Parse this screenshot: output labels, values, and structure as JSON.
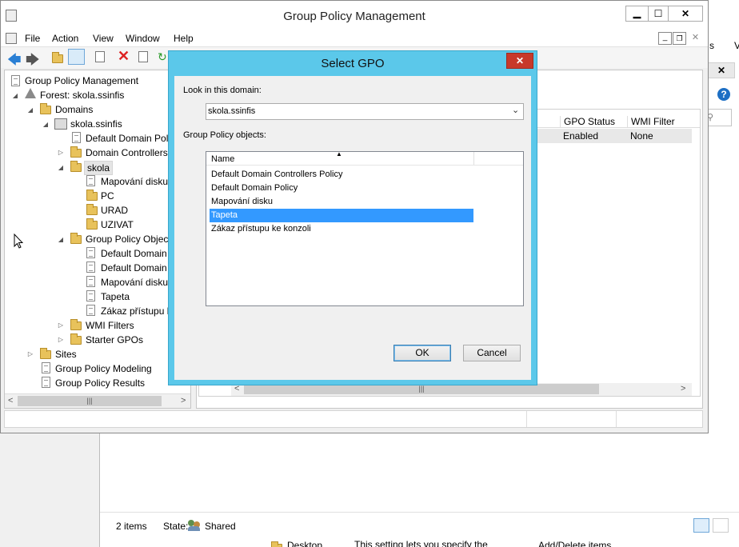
{
  "background_window": {
    "tabs_right": [
      "s",
      "Vi"
    ],
    "status": {
      "items": "2 items",
      "state_label": "State:",
      "state_value": "Shared"
    },
    "bottom_text": {
      "desktop": "Desktop",
      "setting": "This setting lets you specify the",
      "add_delete": "Add/Delete items"
    }
  },
  "gpm_window": {
    "title": "Group Policy Management",
    "menu": [
      "File",
      "Action",
      "View",
      "Window",
      "Help"
    ],
    "tree": {
      "root": "Group Policy Management",
      "forest": "Forest: skola.ssinfis",
      "domains": "Domains",
      "domain": "skola.ssinfis",
      "default_domain_policy": "Default Domain Poli",
      "domain_controllers": "Domain Controllers",
      "skola": "skola",
      "mapovani_link": "Mapování disku",
      "pc": "PC",
      "urad": "URAD",
      "uzivat": "UZIVAT",
      "gpo_folder": "Group Policy Object",
      "gpo_ddcp": "Default Domain",
      "gpo_ddp": "Default Domain",
      "gpo_mapovani": "Mapování disku",
      "gpo_tapeta": "Tapeta",
      "gpo_zakaz": "Zákaz přístupu k",
      "wmi": "WMI Filters",
      "starter": "Starter GPOs",
      "sites": "Sites",
      "modeling": "Group Policy Modeling",
      "results": "Group Policy Results"
    },
    "right_table": {
      "headers": [
        "GPO Status",
        "WMI Filter"
      ],
      "row": [
        "Enabled",
        "None"
      ]
    }
  },
  "dialog": {
    "title": "Select GPO",
    "look_in_label": "Look in this domain:",
    "domain_value": "skola.ssinfis",
    "gpo_label": "Group Policy objects:",
    "column_name": "Name",
    "items": [
      "Default Domain Controllers Policy",
      "Default Domain Policy",
      "Mapování disku",
      "Tapeta",
      "Zákaz přístupu ke konzoli"
    ],
    "selected_index": 3,
    "ok": "OK",
    "cancel": "Cancel",
    "accent": "#5bc8ea",
    "selection_color": "#3399ff"
  }
}
